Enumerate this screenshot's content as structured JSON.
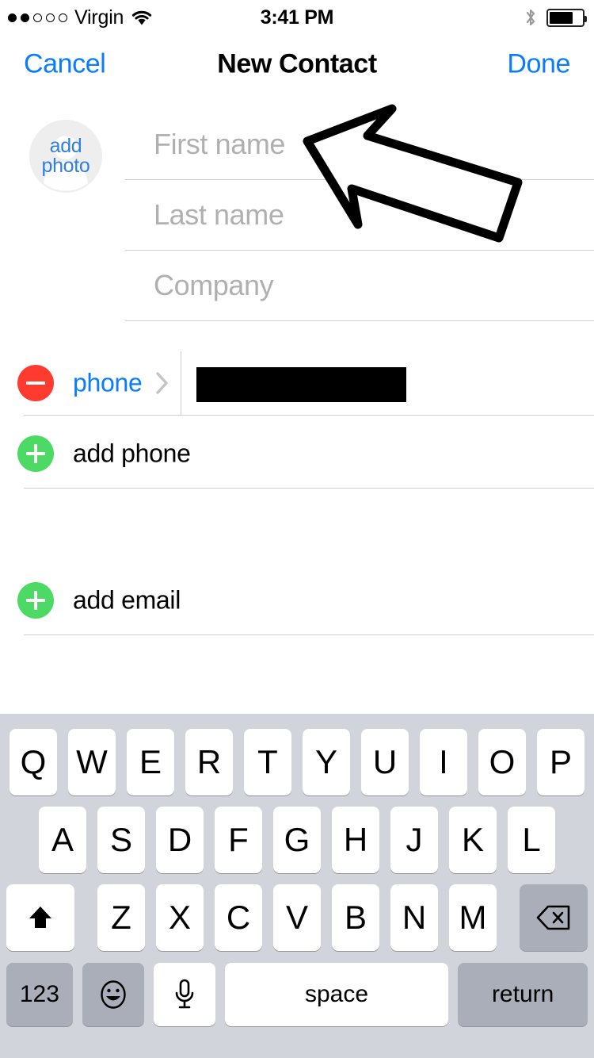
{
  "status_bar": {
    "signal_dots": [
      true,
      true,
      false,
      false,
      false
    ],
    "carrier": "Virgin",
    "wifi_icon": "wifi-icon",
    "time": "3:41 PM",
    "bluetooth_icon": "bluetooth-icon",
    "battery_percent": 72
  },
  "nav": {
    "cancel_label": "Cancel",
    "title": "New Contact",
    "done_label": "Done"
  },
  "form": {
    "avatar_label_line1": "add",
    "avatar_label_line2": "photo",
    "fields": [
      {
        "name": "first-name",
        "placeholder": "First name",
        "value": ""
      },
      {
        "name": "last-name",
        "placeholder": "Last name",
        "value": ""
      },
      {
        "name": "company",
        "placeholder": "Company",
        "value": ""
      }
    ],
    "phone_row": {
      "remove_icon": "minus-circle-icon",
      "label": "phone",
      "chevron_icon": "chevron-right-icon",
      "value": "",
      "redacted": true
    },
    "add_phone": {
      "icon": "plus-circle-icon",
      "label": "add phone"
    },
    "add_email": {
      "icon": "plus-circle-icon",
      "label": "add email"
    }
  },
  "annotation": {
    "arrow_icon": "arrow-up-left-icon",
    "points_to": "first-name"
  },
  "keyboard": {
    "row1": [
      "Q",
      "W",
      "E",
      "R",
      "T",
      "Y",
      "U",
      "I",
      "O",
      "P"
    ],
    "row2": [
      "A",
      "S",
      "D",
      "F",
      "G",
      "H",
      "J",
      "K",
      "L"
    ],
    "row3_letters": [
      "Z",
      "X",
      "C",
      "V",
      "B",
      "N",
      "M"
    ],
    "shift_icon": "shift-up-arrow-icon",
    "backspace_icon": "delete-backspace-icon",
    "numbers_label": "123",
    "emoji_icon": "emoji-smiley-icon",
    "mic_icon": "microphone-icon",
    "space_label": "space",
    "return_label": "return"
  },
  "colors": {
    "accent_blue": "#0a7cff",
    "remove_red": "#ff3b30",
    "add_green": "#4cd964",
    "placeholder_gray": "#b0b0b0",
    "keyboard_bg": "#d1d4db",
    "key_gray": "#a9aeb8"
  }
}
